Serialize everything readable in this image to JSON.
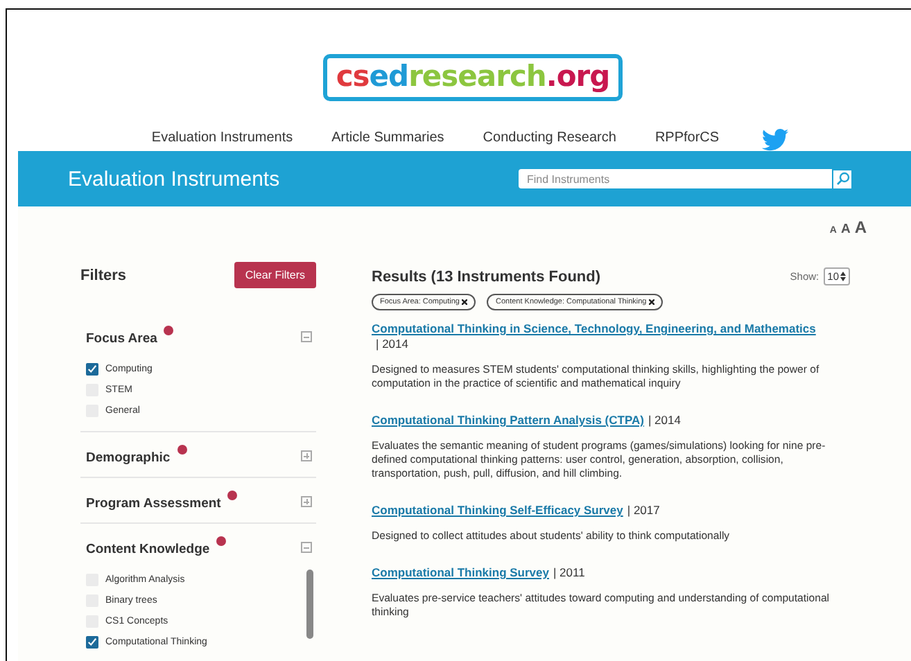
{
  "logo": {
    "parts": [
      {
        "text": "cs",
        "color": "#e03a3e"
      },
      {
        "text": "ed",
        "color": "#1f9ad6"
      },
      {
        "text": "research",
        "color": "#8cc63f"
      },
      {
        "text": ".org",
        "color": "#c8174f"
      }
    ]
  },
  "nav": {
    "items": [
      "Evaluation Instruments",
      "Article Summaries",
      "Conducting Research",
      "RPPforCS"
    ]
  },
  "banner": {
    "title": "Evaluation Instruments",
    "search": {
      "placeholder": "Find Instruments"
    }
  },
  "text_size": {
    "options": [
      "A",
      "A",
      "A"
    ]
  },
  "filters": {
    "title": "Filters",
    "clear_button": "Clear Filters",
    "groups": [
      {
        "label": "Focus Area",
        "expanded": true,
        "options": [
          {
            "label": "Computing",
            "checked": true
          },
          {
            "label": "STEM",
            "checked": false
          },
          {
            "label": "General",
            "checked": false
          }
        ]
      },
      {
        "label": "Demographic",
        "expanded": false
      },
      {
        "label": "Program Assessment",
        "expanded": false
      },
      {
        "label": "Content Knowledge",
        "expanded": true,
        "options": [
          {
            "label": "Algorithm Analysis",
            "checked": false
          },
          {
            "label": "Binary trees",
            "checked": false
          },
          {
            "label": "CS1 Concepts",
            "checked": false
          },
          {
            "label": "Computational Thinking",
            "checked": true
          }
        ]
      }
    ]
  },
  "results": {
    "title": "Results (13 Instruments Found)",
    "show_label": "Show:",
    "show_value": "10",
    "active_filters": [
      "Focus Area: Computing",
      "Content Knowledge: Computational Thinking"
    ],
    "items": [
      {
        "title": "Computational Thinking in Science, Technology, Engineering, and Mathematics",
        "year": "| 2014",
        "description": "Designed to measures STEM students' computational thinking skills, highlighting the power of computation in the practice of scientific and mathematical inquiry"
      },
      {
        "title": "Computational Thinking Pattern Analysis (CTPA)",
        "year": "| 2014",
        "description": "Evaluates the semantic meaning of student programs (games/simulations) looking for nine pre-defined computational thinking patterns: user control, generation, absorption, collision, transportation, push, pull, diffusion, and hill climbing."
      },
      {
        "title": "Computational Thinking Self-Efficacy Survey",
        "year": "| 2017",
        "description": "Designed to collect attitudes about students' ability to think computationally"
      },
      {
        "title": "Computational Thinking Survey",
        "year": "| 2011",
        "description": "Evaluates pre-service teachers' attitudes toward computing and understanding of computational thinking"
      }
    ]
  }
}
